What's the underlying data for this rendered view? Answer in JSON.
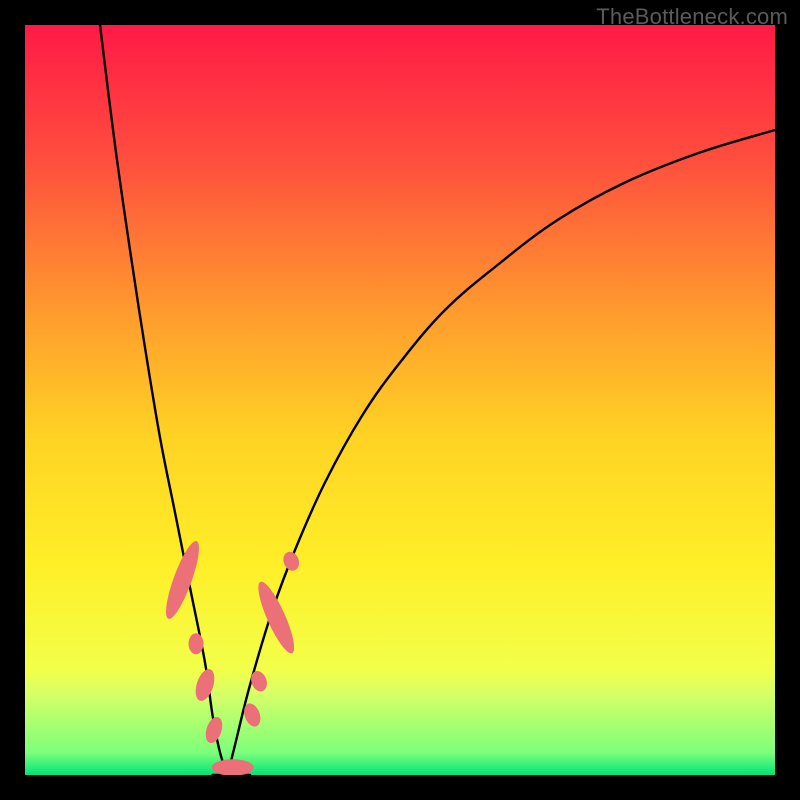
{
  "watermark": {
    "text": "TheBottleneck.com"
  },
  "gradient": {
    "stops": [
      {
        "offset": 0,
        "color": "#ff1a46"
      },
      {
        "offset": 18,
        "color": "#ff4e3e"
      },
      {
        "offset": 38,
        "color": "#ff9a2e"
      },
      {
        "offset": 55,
        "color": "#ffd324"
      },
      {
        "offset": 72,
        "color": "#ffef28"
      },
      {
        "offset": 86,
        "color": "#f2ff4a"
      },
      {
        "offset": 89,
        "color": "#d8ff66"
      },
      {
        "offset": 97,
        "color": "#7dff7a"
      },
      {
        "offset": 100,
        "color": "#00e47a"
      }
    ]
  },
  "chart_data": {
    "type": "line",
    "title": "",
    "xlabel": "",
    "ylabel": "",
    "xlim": [
      0,
      100
    ],
    "ylim": [
      0,
      100
    ],
    "notch_x": 27,
    "series": [
      {
        "name": "left-curve",
        "x": [
          10,
          12,
          14,
          16,
          18,
          20,
          22,
          24,
          25,
          26,
          27
        ],
        "y": [
          100,
          84,
          70,
          57,
          45,
          35,
          25,
          15,
          8,
          3,
          0
        ]
      },
      {
        "name": "right-curve",
        "x": [
          27,
          28,
          30,
          33,
          36,
          40,
          45,
          50,
          56,
          63,
          71,
          80,
          90,
          100
        ],
        "y": [
          0,
          4,
          12,
          22,
          30,
          39,
          48,
          55,
          62,
          68,
          74,
          79,
          83,
          86
        ]
      },
      {
        "name": "floor",
        "x": [
          25,
          30
        ],
        "y": [
          0,
          0
        ]
      }
    ],
    "markers": [
      {
        "name": "left-cluster-blob",
        "cx": 21.0,
        "cy": 26.0,
        "rx": 1.2,
        "ry": 5.5,
        "rot": 20
      },
      {
        "name": "left-cluster-dot-a",
        "cx": 22.8,
        "cy": 17.5,
        "rx": 1.0,
        "ry": 1.4,
        "rot": 0
      },
      {
        "name": "left-cluster-dot-b",
        "cx": 24.0,
        "cy": 12.0,
        "rx": 1.1,
        "ry": 2.2,
        "rot": 18
      },
      {
        "name": "left-cluster-dot-c",
        "cx": 25.2,
        "cy": 6.0,
        "rx": 1.0,
        "ry": 1.8,
        "rot": 18
      },
      {
        "name": "floor-blob",
        "cx": 27.7,
        "cy": 1.0,
        "rx": 2.8,
        "ry": 1.1,
        "rot": 0
      },
      {
        "name": "right-cluster-dot-a",
        "cx": 30.3,
        "cy": 8.0,
        "rx": 1.0,
        "ry": 1.6,
        "rot": -20
      },
      {
        "name": "right-cluster-dot-b",
        "cx": 31.2,
        "cy": 12.5,
        "rx": 1.0,
        "ry": 1.4,
        "rot": -20
      },
      {
        "name": "right-cluster-blob",
        "cx": 33.5,
        "cy": 21.0,
        "rx": 1.2,
        "ry": 5.2,
        "rot": -24
      },
      {
        "name": "right-cluster-dot-c",
        "cx": 35.5,
        "cy": 28.5,
        "rx": 1.0,
        "ry": 1.3,
        "rot": -22
      }
    ],
    "marker_color": "#eb7077",
    "curve_color": "#000000",
    "curve_width": 2.4
  }
}
